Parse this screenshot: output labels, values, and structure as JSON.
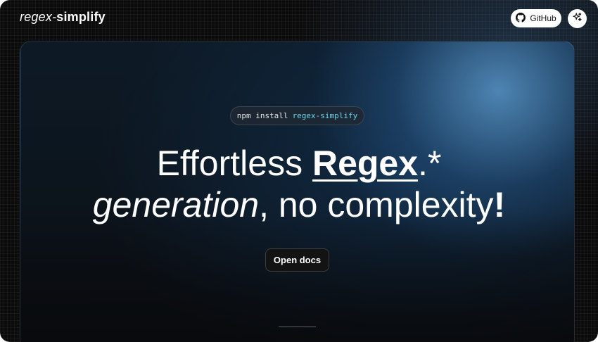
{
  "header": {
    "logo_prefix": "regex-",
    "logo_suffix": "simplify",
    "github_label": "GitHub",
    "github_icon": "github-icon",
    "theme_icon": "sparkle-icon"
  },
  "hero": {
    "install_command": "npm install",
    "install_package": "regex-simplify",
    "headline_line1_plain": "Effortless ",
    "headline_line1_strong": "Regex",
    "headline_line1_tail": ".*",
    "headline_line2_em": "generation",
    "headline_line2_plain": ", no complexity",
    "headline_line2_bang": "!",
    "docs_button_label": "Open docs"
  },
  "colors": {
    "background": "#0b0b0c",
    "accent": "#6fd6ea",
    "glow": "#5896c8"
  }
}
